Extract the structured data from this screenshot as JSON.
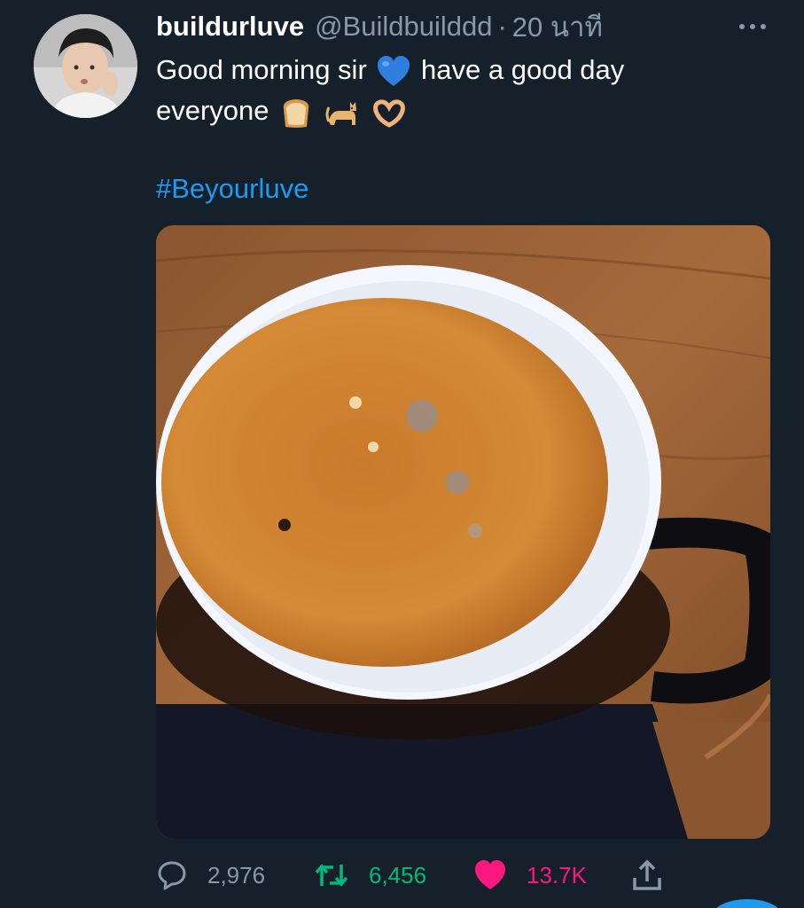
{
  "tweet": {
    "display_name": "buildurluve",
    "handle": "@Buildbuilddd",
    "separator": "·",
    "time": "20 นาที",
    "text_part1": "Good morning sir",
    "text_part2": "have a good day",
    "text_part3": "everyone",
    "emojis": [
      "blue-heart-icon",
      "bread-icon",
      "cat-icon",
      "heart-hands-icon"
    ],
    "hashtag": "#Beyourluve"
  },
  "actions": {
    "replies": "2,976",
    "retweets": "6,456",
    "likes": "13.7K"
  },
  "colors": {
    "background": "#15202b",
    "secondary_text": "#8b98a5",
    "link": "#1d9bf0",
    "retweet": "#00ba7c",
    "like": "#f91880"
  }
}
